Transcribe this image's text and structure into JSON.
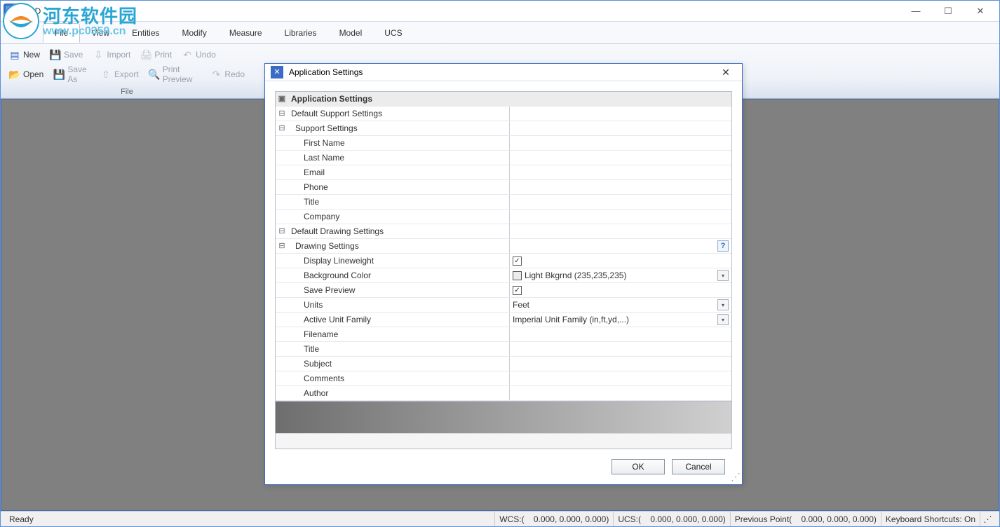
{
  "window": {
    "title": "CAD"
  },
  "watermark": {
    "line1": "河东软件园",
    "line2": "www.pc0359.cn"
  },
  "menubar": {
    "items": [
      "File",
      "View",
      "Entities",
      "Modify",
      "Measure",
      "Libraries",
      "Model",
      "UCS"
    ],
    "activeIndex": 0
  },
  "ribbon": {
    "group_label": "File",
    "row1": [
      {
        "label": "New",
        "icon": "▤"
      },
      {
        "label": "Save",
        "icon": "💾",
        "disabled": true
      },
      {
        "label": "Import",
        "icon": "⇩",
        "disabled": true
      },
      {
        "label": "Print",
        "icon": "🖨",
        "disabled": true
      },
      {
        "label": "Undo",
        "icon": "↶",
        "disabled": true
      }
    ],
    "row2": [
      {
        "label": "Open",
        "icon": "📂"
      },
      {
        "label": "Save As",
        "icon": "💾",
        "disabled": true
      },
      {
        "label": "Export",
        "icon": "⇧",
        "disabled": true
      },
      {
        "label": "Print Preview",
        "icon": "🔍",
        "disabled": true
      },
      {
        "label": "Redo",
        "icon": "↷",
        "disabled": true
      }
    ]
  },
  "dialog": {
    "title": "Application Settings",
    "ok": "OK",
    "cancel": "Cancel",
    "sections": {
      "app_settings": "Application Settings",
      "default_support": "Default Support Settings",
      "support_settings": "Support Settings",
      "first_name": "First Name",
      "last_name": "Last Name",
      "email": "Email",
      "phone": "Phone",
      "title": "Title",
      "company": "Company",
      "default_drawing": "Default Drawing Settings",
      "drawing_settings": "Drawing Settings",
      "display_lineweight": "Display Lineweight",
      "background_color": "Background Color",
      "bg_value": "Light Bkgrnd (235,235,235)",
      "save_preview": "Save Preview",
      "units": "Units",
      "units_value": "Feet",
      "active_unit_family": "Active Unit Family",
      "auf_value": "Imperial Unit Family (in,ft,yd,...)",
      "filename": "Filename",
      "title2": "Title",
      "subject": "Subject",
      "comments": "Comments",
      "author": "Author"
    }
  },
  "statusbar": {
    "ready": "Ready",
    "wcs_label": "WCS:(",
    "wcs": "0.000,      0.000,      0.000)",
    "ucs_label": "UCS:(",
    "ucs": "0.000,      0.000,      0.000)",
    "prev_label": "Previous Point(",
    "prev": "0.000,      0.000,      0.000)",
    "kb": "Keyboard Shortcuts: On"
  },
  "colors": {
    "bg_swatch": "#ebebeb"
  }
}
